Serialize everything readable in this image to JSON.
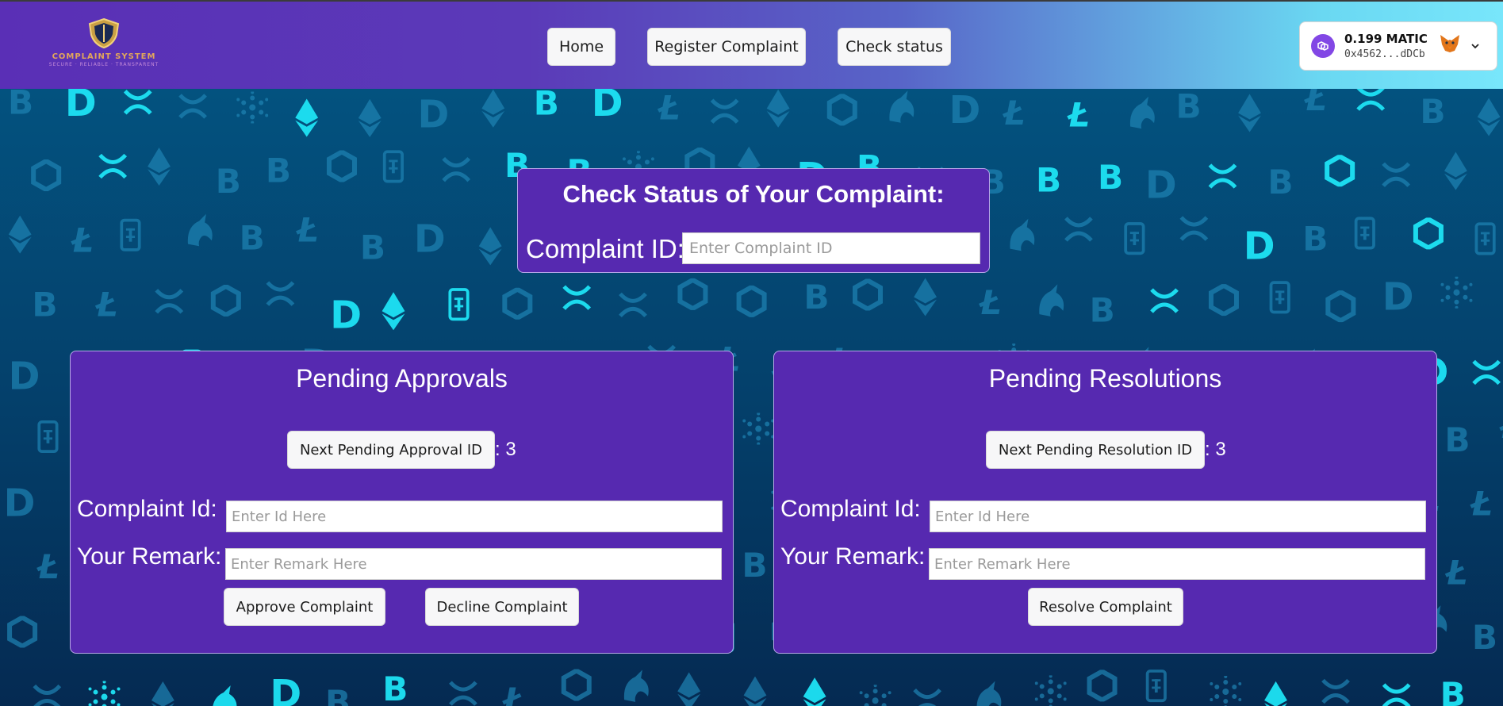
{
  "header": {
    "logo": {
      "text": "COMPLAINT SYSTEM",
      "subtext": "SECURE · RELIABLE · TRANSPARENT"
    },
    "nav": {
      "home": "Home",
      "register": "Register Complaint",
      "check": "Check status"
    },
    "wallet": {
      "balance": "0.199 MATIC",
      "address": "0x4562...dDCb",
      "chain_icon": "polygon-icon",
      "wallet_icon": "metamask-fox-icon"
    }
  },
  "status": {
    "title": "Check Status of Your Complaint:",
    "label": "Complaint ID:",
    "placeholder": "Enter Complaint ID"
  },
  "approvals": {
    "title": "Pending Approvals",
    "next_button": "Next Pending Approval ID",
    "count": ": 3",
    "id_label": "Complaint Id:",
    "id_placeholder": "Enter Id Here",
    "remark_label": "Your Remark:",
    "remark_placeholder": "Enter Remark Here",
    "approve_button": "Approve Complaint",
    "decline_button": "Decline Complaint"
  },
  "resolutions": {
    "title": "Pending Resolutions",
    "next_button": "Next Pending Resolution ID",
    "count": ": 3",
    "id_label": "Complaint Id:",
    "id_placeholder": "Enter Id Here",
    "remark_label": "Your Remark:",
    "remark_placeholder": "Enter Remark Here",
    "resolve_button": "Resolve Complaint"
  },
  "colors": {
    "panel": "#5629b0",
    "background": "#052f57",
    "accent_cyan": "#26c6e6"
  }
}
